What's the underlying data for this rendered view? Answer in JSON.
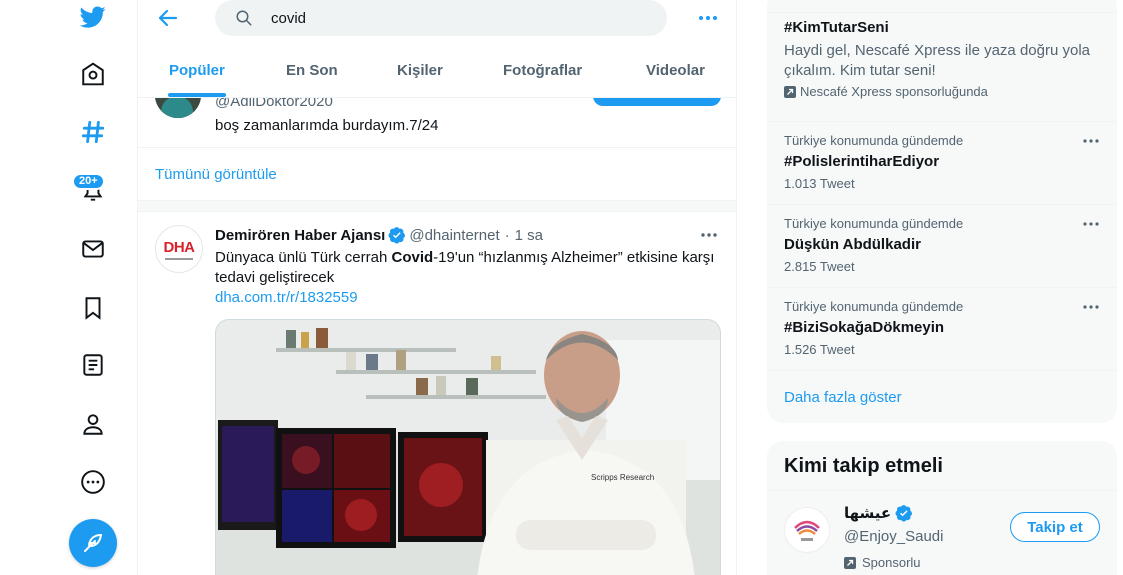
{
  "nav": {
    "badge": "20+"
  },
  "search": {
    "value": "covid"
  },
  "tabs": [
    {
      "label": "Popüler",
      "active": true
    },
    {
      "label": "En Son",
      "active": false
    },
    {
      "label": "Kişiler",
      "active": false
    },
    {
      "label": "Fotoğraflar",
      "active": false
    },
    {
      "label": "Videolar",
      "active": false
    }
  ],
  "partial_tweet": {
    "handle": "@AdilDoktor2020",
    "text": "boş zamanlarımda burdayım.7/24"
  },
  "show_all": "Tümünü görüntüle",
  "tweet": {
    "name": "Demirören Haber Ajansı",
    "handle": "@dhainternet",
    "dot": "·",
    "time": "1 sa",
    "avatar_logo": "DHA",
    "text_before": "Dünyaca ünlü Türk cerrah ",
    "text_bold": "Covid",
    "text_after": "-19'un “hızlanmış Alzheimer” etkisine karşı tedavi geliştirecek",
    "link": "dha.com.tr/r/1832559",
    "coat_label": "Scripps Research"
  },
  "promo_trend": {
    "title": "#KimTutarSeni",
    "description": "Haydi gel, Nescafé Xpress ile yaza doğru yola çıkalım. Kim tutar seni!",
    "sponsor": "Nescafé Xpress sponsorluğunda"
  },
  "trends": [
    {
      "context": "Türkiye konumunda gündemde",
      "name": "#PolislerintiharEdiyor",
      "count": "1.013 Tweet"
    },
    {
      "context": "Türkiye konumunda gündemde",
      "name": "Düşkün Abdülkadir",
      "count": "2.815 Tweet"
    },
    {
      "context": "Türkiye konumunda gündemde",
      "name": "#BiziSokağaDökmeyin",
      "count": "1.526 Tweet"
    }
  ],
  "show_more": "Daha fazla göster",
  "who_to_follow": {
    "title": "Kimi takip etmeli",
    "name": "عيشها",
    "handle": "@Enjoy_Saudi",
    "promoted": "Sponsorlu",
    "button": "Takip et"
  },
  "colors": {
    "accent": "#1d9bf0",
    "text": "#0f1419",
    "secondary": "#536471"
  }
}
